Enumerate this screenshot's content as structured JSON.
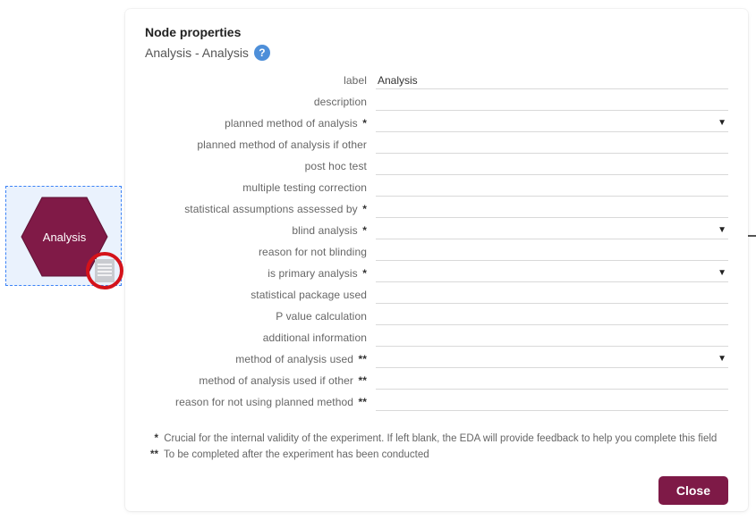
{
  "node": {
    "label": "Analysis"
  },
  "panel": {
    "title": "Node properties",
    "subtitle": "Analysis - Analysis",
    "close_label": "Close"
  },
  "fields": {
    "label": {
      "label": "label",
      "value": "Analysis",
      "type": "text"
    },
    "description": {
      "label": "description",
      "value": "",
      "type": "text"
    },
    "planned_method": {
      "label": "planned method of analysis",
      "value": "",
      "type": "select",
      "required": "single"
    },
    "planned_method_other": {
      "label": "planned method of analysis if other",
      "value": "",
      "type": "text"
    },
    "post_hoc": {
      "label": "post hoc test",
      "value": "",
      "type": "text"
    },
    "multiple_testing": {
      "label": "multiple testing correction",
      "value": "",
      "type": "text"
    },
    "stat_assumptions": {
      "label": "statistical assumptions assessed by",
      "value": "",
      "type": "text",
      "required": "single"
    },
    "blind_analysis": {
      "label": "blind analysis",
      "value": "",
      "type": "select",
      "required": "single"
    },
    "reason_not_blinding": {
      "label": "reason for not blinding",
      "value": "",
      "type": "text"
    },
    "is_primary": {
      "label": "is primary analysis",
      "value": "",
      "type": "select",
      "required": "single"
    },
    "stat_package": {
      "label": "statistical package used",
      "value": "",
      "type": "text"
    },
    "p_value_calc": {
      "label": "P value calculation",
      "value": "",
      "type": "text"
    },
    "additional_info": {
      "label": "additional information",
      "value": "",
      "type": "text"
    },
    "method_used": {
      "label": "method of analysis used",
      "value": "",
      "type": "select",
      "required": "double"
    },
    "method_used_other": {
      "label": "method of analysis used if other",
      "value": "",
      "type": "text",
      "required": "double"
    },
    "reason_not_planned": {
      "label": "reason for not using planned method",
      "value": "",
      "type": "text",
      "required": "double"
    }
  },
  "footnotes": {
    "single": "Crucial for the internal validity of the experiment. If left blank, the EDA will provide feedback to help you complete this field",
    "double": "To be completed after the experiment has been conducted"
  }
}
